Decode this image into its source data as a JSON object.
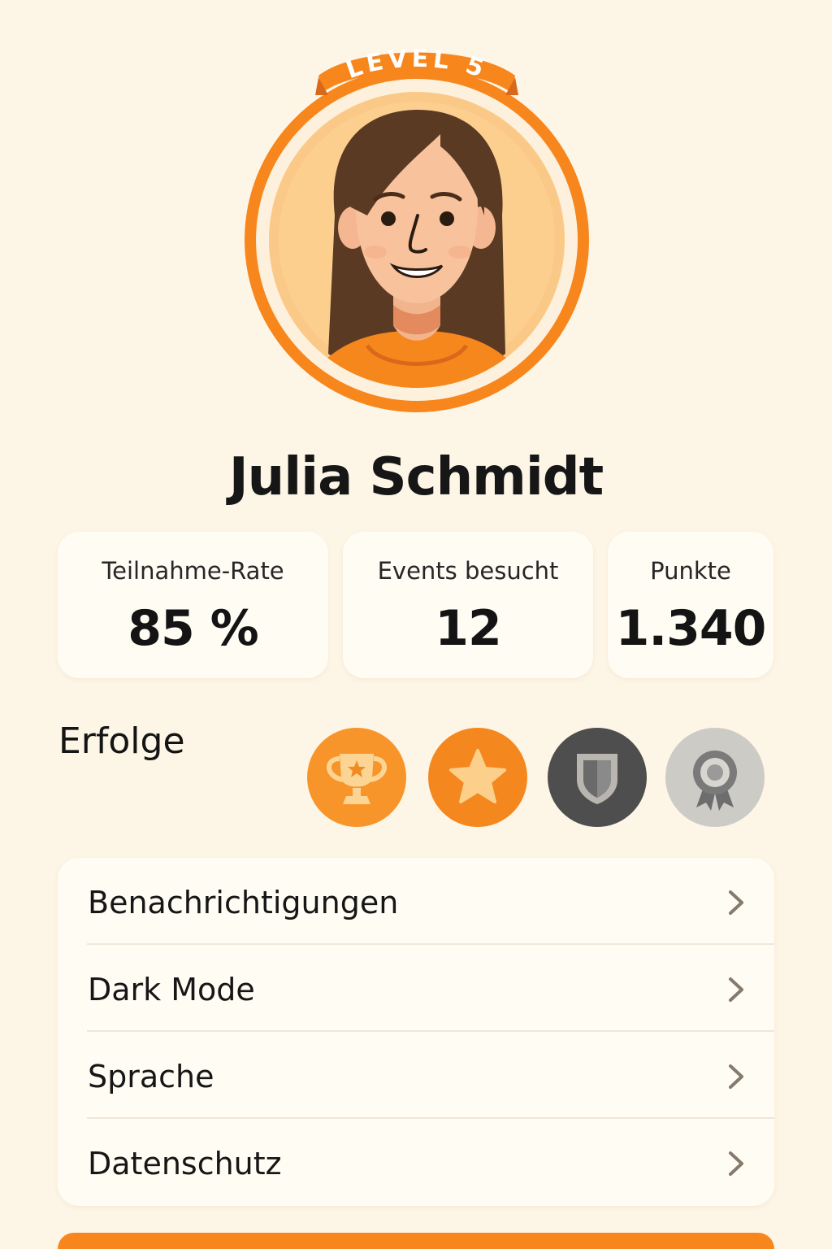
{
  "profile": {
    "level_label": "LEVEL 5",
    "name": "Julia Schmidt"
  },
  "stats": [
    {
      "label": "Teilnahme-Rate",
      "value": "85 %"
    },
    {
      "label": "Events besucht",
      "value": "12"
    },
    {
      "label": "Punkte",
      "value": "1.340"
    }
  ],
  "achievements": {
    "title": "Erfolge",
    "badges": [
      {
        "icon": "trophy-icon",
        "color": "#f8952a"
      },
      {
        "icon": "star-icon",
        "color": "#f5871f"
      },
      {
        "icon": "shield-icon",
        "color": "#4e4e4e"
      },
      {
        "icon": "ribbon-medal-icon",
        "color": "#cdcbc5"
      }
    ]
  },
  "settings": {
    "items": [
      {
        "label": "Benachrichtigungen"
      },
      {
        "label": "Dark Mode"
      },
      {
        "label": "Sprache"
      },
      {
        "label": "Datenschutz"
      }
    ]
  },
  "colors": {
    "background": "#fdf5e6",
    "accent": "#f7861d",
    "card": "#fffcf4",
    "text": "#161616"
  }
}
